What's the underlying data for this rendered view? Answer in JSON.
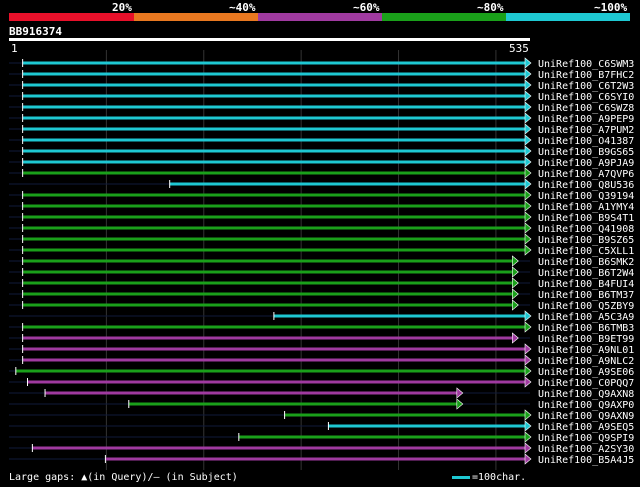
{
  "legend": {
    "labels": [
      "20%",
      "~40%",
      "~60%",
      "~80%",
      "~100%"
    ],
    "colors": [
      "#e8102a",
      "#e87820",
      "#a03aa0",
      "#1aa01a",
      "#1ec8d2"
    ]
  },
  "query": {
    "id": "BB916374",
    "start": "1",
    "end": "535"
  },
  "footer": {
    "gaps_text": "Large gaps: ▲(in Query)/– (in Subject)",
    "scale_text": "=100char."
  },
  "chart_data": {
    "type": "alignment",
    "query_length": 535,
    "hits": [
      {
        "name": "UniRef100_C6SWM3",
        "start": 14,
        "end": 535,
        "color": "cyan"
      },
      {
        "name": "UniRef100_B7FHC2",
        "start": 14,
        "end": 535,
        "color": "cyan"
      },
      {
        "name": "UniRef100_C6T2W3",
        "start": 14,
        "end": 535,
        "color": "cyan"
      },
      {
        "name": "UniRef100_C6SYI0",
        "start": 14,
        "end": 535,
        "color": "cyan"
      },
      {
        "name": "UniRef100_C6SWZ8",
        "start": 14,
        "end": 535,
        "color": "cyan"
      },
      {
        "name": "UniRef100_A9PEP9",
        "start": 14,
        "end": 535,
        "color": "cyan"
      },
      {
        "name": "UniRef100_A7PUM2",
        "start": 14,
        "end": 535,
        "color": "cyan"
      },
      {
        "name": "UniRef100_O41387",
        "start": 14,
        "end": 535,
        "color": "cyan"
      },
      {
        "name": "UniRef100_B9GS65",
        "start": 14,
        "end": 535,
        "color": "cyan"
      },
      {
        "name": "UniRef100_A9PJA9",
        "start": 14,
        "end": 535,
        "color": "cyan"
      },
      {
        "name": "UniRef100_A7QVP6",
        "start": 14,
        "end": 535,
        "color": "green"
      },
      {
        "name": "UniRef100_Q8U536",
        "start": 165,
        "end": 535,
        "color": "cyan"
      },
      {
        "name": "UniRef100_Q39194",
        "start": 14,
        "end": 535,
        "color": "green"
      },
      {
        "name": "UniRef100_A1YMY4",
        "start": 14,
        "end": 535,
        "color": "green"
      },
      {
        "name": "UniRef100_B9S4T1",
        "start": 14,
        "end": 535,
        "color": "green"
      },
      {
        "name": "UniRef100_Q41908",
        "start": 14,
        "end": 535,
        "color": "green"
      },
      {
        "name": "UniRef100_B9SZ65",
        "start": 14,
        "end": 535,
        "color": "green"
      },
      {
        "name": "UniRef100_C5XLL1",
        "start": 14,
        "end": 535,
        "color": "green"
      },
      {
        "name": "UniRef100_B6SMK2",
        "start": 14,
        "end": 522,
        "color": "green"
      },
      {
        "name": "UniRef100_B6T2W4",
        "start": 14,
        "end": 522,
        "color": "green"
      },
      {
        "name": "UniRef100_B4FUI4",
        "start": 14,
        "end": 522,
        "color": "green"
      },
      {
        "name": "UniRef100_B6TM37",
        "start": 14,
        "end": 522,
        "color": "green"
      },
      {
        "name": "UniRef100_Q5ZBY9",
        "start": 14,
        "end": 522,
        "color": "green"
      },
      {
        "name": "UniRef100_A5C3A9",
        "start": 272,
        "end": 535,
        "color": "cyan"
      },
      {
        "name": "UniRef100_B6TMB3",
        "start": 14,
        "end": 535,
        "color": "green"
      },
      {
        "name": "UniRef100_B9ET99",
        "start": 14,
        "end": 522,
        "color": "purple"
      },
      {
        "name": "UniRef100_A9NL01",
        "start": 14,
        "end": 535,
        "color": "purple"
      },
      {
        "name": "UniRef100_A9NLC2",
        "start": 14,
        "end": 535,
        "color": "purple"
      },
      {
        "name": "UniRef100_A9SE06",
        "start": 7,
        "end": 535,
        "color": "green"
      },
      {
        "name": "UniRef100_C0PQQ7",
        "start": 19,
        "end": 535,
        "color": "purple"
      },
      {
        "name": "UniRef100_Q9AXN8",
        "start": 37,
        "end": 465,
        "color": "purple"
      },
      {
        "name": "UniRef100_Q9AXP0",
        "start": 123,
        "end": 465,
        "color": "green"
      },
      {
        "name": "UniRef100_Q9AXN9",
        "start": 283,
        "end": 535,
        "color": "green"
      },
      {
        "name": "UniRef100_A9SEQ5",
        "start": 328,
        "end": 535,
        "color": "cyan"
      },
      {
        "name": "UniRef100_Q9SPI9",
        "start": 236,
        "end": 535,
        "color": "green"
      },
      {
        "name": "UniRef100_A2SY30",
        "start": 24,
        "end": 535,
        "color": "purple"
      },
      {
        "name": "UniRef100_B5A4J5",
        "start": 99,
        "end": 535,
        "color": "purple"
      }
    ]
  }
}
